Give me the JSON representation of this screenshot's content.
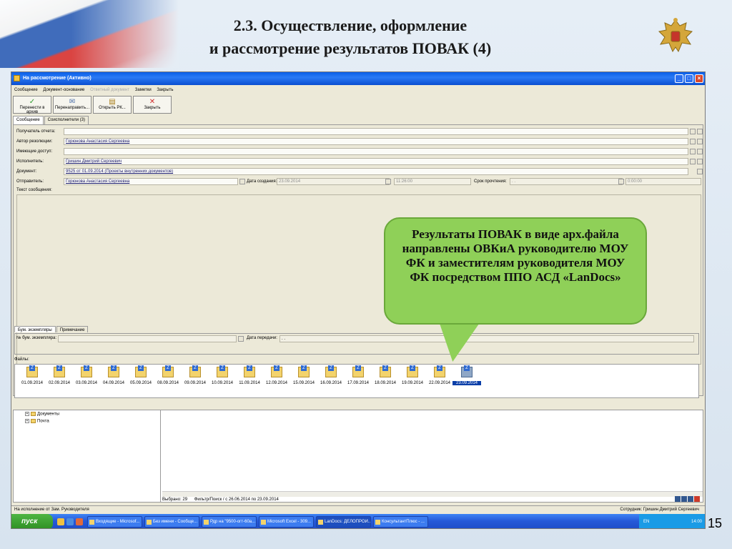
{
  "slide": {
    "title_line1": "2.3. Осуществление, оформление",
    "title_line2": "и рассмотрение результатов ПОВАК (4)",
    "number": "15"
  },
  "window": {
    "title": "На рассмотрение (Активно)",
    "menu": [
      "Сообщение",
      "Документ-основание",
      "Ответный документ",
      "Заметки",
      "Закрыть"
    ],
    "toolbar": [
      "Перенести в архив",
      "Перенаправить...",
      "Открыть РК...",
      "Закрыть"
    ],
    "tabs": [
      "Сообщение",
      "Соисполнители (3)"
    ]
  },
  "form": {
    "recipient_label": "Получатель отчета:",
    "recipient_value": "",
    "author_label": "Автор резолюции:",
    "author_value": "Горюнова Анастасия Сергеевна",
    "access_label": "Имеющие доступ:",
    "access_value": "",
    "executor_label": "Исполнитель:",
    "executor_value": "Гришин Дмитрий Сергеевич",
    "document_label": "Документ:",
    "document_value": "9525 от 01.09.2014 (Проекты внутренних документов)",
    "sender_label": "Отправитель:",
    "sender_value": "Горюнова Анастасия Сергеевна",
    "created_label": "Дата создания:",
    "created_date": "23.09.2014",
    "created_time": "11:26:00",
    "deadline_label": "Срок прочтения:",
    "deadline_date": ". .",
    "deadline_time": "0:00:00",
    "text_label": "Текст сообщения:"
  },
  "lower": {
    "tabs": [
      "Бум. экземпляры",
      "Примечание"
    ],
    "copy_label": "№ бум. экземпляра:",
    "transfer_label": "Дата передачи:",
    "transfer_value": ". .",
    "files_label": "Файлы:",
    "files": [
      "01.09.2014",
      "02.09.2014",
      "03.09.2014",
      "04.09.2014",
      "05.09.2014",
      "08.09.2014",
      "09.09.2014",
      "10.09.2014",
      "11.09.2014",
      "12.09.2014",
      "15.09.2014",
      "16.09.2014",
      "17.09.2014",
      "18.09.2014",
      "19.09.2014",
      "22.09.2014",
      "23.09.2014"
    ],
    "selected_file": "23.09.2014"
  },
  "tree": [
    "Документы",
    "Почта"
  ],
  "status": {
    "selected": "Выбрано: 29",
    "filter": "Фильтр/Поиск / с 26.06.2014 по 23.09.2014",
    "left": "На исполнение от Зам. Руководителя",
    "employee": "Сотрудник: Гришин Дмитрий Сергеевич"
  },
  "taskbar": {
    "start": "пуск",
    "tasks": [
      "Входящие - Microsof...",
      "Без имени - Сообще...",
      "Рдр на \"9500-огт-60а...",
      "Microsoft Excel - 309...",
      "LanDocs: ДЕЛОПРОИ...",
      "КонсультантПлюс - ..."
    ],
    "lang": "EN",
    "clock": "14:00"
  },
  "callout": "Результаты ПОВАК в виде арх.файла направлены ОВКиА руководителю МОУ ФК и заместителям руководителя МОУ ФК посредством ППО АСД «LanDocs»"
}
